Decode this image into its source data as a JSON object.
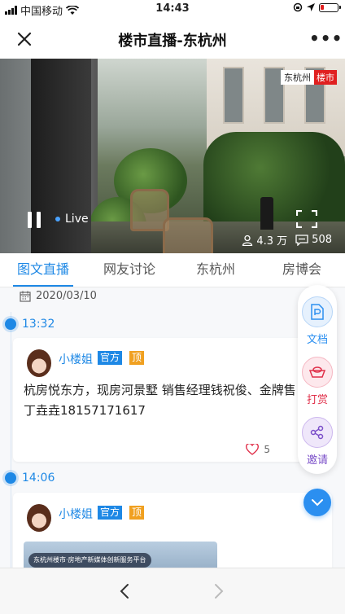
{
  "status": {
    "carrier": "中国移动",
    "time": "14:43"
  },
  "header": {
    "title": "楼市直播-东杭州",
    "more": "•••"
  },
  "video": {
    "watermark_a": "东杭州",
    "watermark_b": "楼市",
    "live_label": "Live",
    "viewers": "4.3 万",
    "comments": "508"
  },
  "tabs": [
    {
      "label": "图文直播",
      "active": true
    },
    {
      "label": "网友讨论",
      "active": false
    },
    {
      "label": "东杭州",
      "active": false
    },
    {
      "label": "房博会",
      "active": false
    }
  ],
  "feed": {
    "date": "2020/03/10",
    "posts": [
      {
        "time": "13:32",
        "author": "小楼姐",
        "badge_official": "官方",
        "badge_top": "顶",
        "content": "杭房悦东方，现房河景墅 销售经理钱祝俊、金牌售丁垚垚18157171617",
        "likes": "5"
      },
      {
        "time": "14:06",
        "author": "小楼姐",
        "badge_official": "官方",
        "badge_top": "顶",
        "image_caption": "东杭州楼市·房地产新媒体创新服务平台"
      }
    ]
  },
  "actions": [
    {
      "label": "文档",
      "color": "#2b8ff0",
      "icon": "document-icon"
    },
    {
      "label": "打赏",
      "color": "#e0304a",
      "icon": "reward-icon"
    },
    {
      "label": "邀请",
      "color": "#7b4fc9",
      "icon": "share-icon"
    }
  ]
}
